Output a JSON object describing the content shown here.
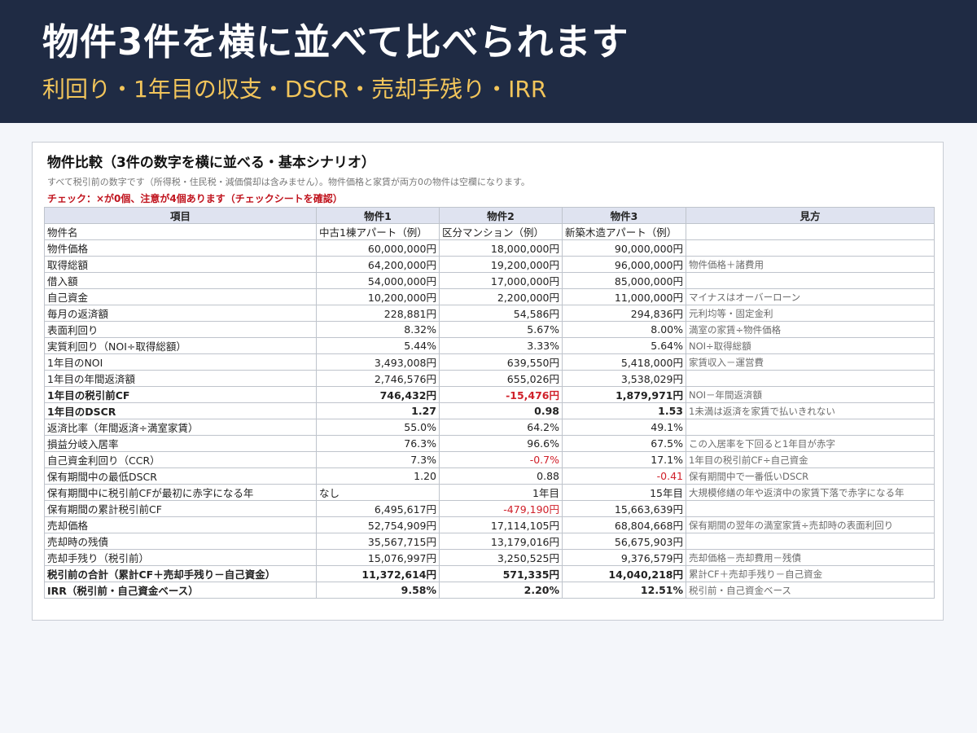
{
  "header": {
    "title": "物件3件を横に並べて比べられます",
    "subtitle": "利回り・1年目の収支・DSCR・売却手残り・IRR"
  },
  "panel": {
    "title": "物件比較（3件の数字を横に並べる・基本シナリオ）",
    "note": "すべて税引前の数字です（所得税・住民税・減価償却は含みません）。物件価格と家賃が両方0の物件は空欄になります。",
    "check": "チェック：×が0個、注意が4個あります（チェックシートを確認）"
  },
  "table": {
    "headers": [
      "項目",
      "物件1",
      "物件2",
      "物件3",
      "見方"
    ],
    "rows": [
      {
        "label": "物件名",
        "values": [
          "中古1棟アパート（例）",
          "区分マンション（例）",
          "新築木造アパート（例）"
        ],
        "note": "",
        "align": "left"
      },
      {
        "label": "物件価格",
        "values": [
          "60,000,000円",
          "18,000,000円",
          "90,000,000円"
        ],
        "note": ""
      },
      {
        "label": "取得総額",
        "values": [
          "64,200,000円",
          "19,200,000円",
          "96,000,000円"
        ],
        "note": "物件価格＋諸費用"
      },
      {
        "label": "借入額",
        "values": [
          "54,000,000円",
          "17,000,000円",
          "85,000,000円"
        ],
        "note": ""
      },
      {
        "label": "自己資金",
        "values": [
          "10,200,000円",
          "2,200,000円",
          "11,000,000円"
        ],
        "note": "マイナスはオーバーローン"
      },
      {
        "label": "毎月の返済額",
        "values": [
          "228,881円",
          "54,586円",
          "294,836円"
        ],
        "note": "元利均等・固定金利"
      },
      {
        "label": "表面利回り",
        "values": [
          "8.32%",
          "5.67%",
          "8.00%"
        ],
        "note": "満室の家賃÷物件価格"
      },
      {
        "label": "実質利回り（NOI÷取得総額）",
        "values": [
          "5.44%",
          "3.33%",
          "5.64%"
        ],
        "note": "NOI÷取得総額"
      },
      {
        "label": "1年目のNOI",
        "values": [
          "3,493,008円",
          "639,550円",
          "5,418,000円"
        ],
        "note": "家賃収入－運営費"
      },
      {
        "label": "1年目の年間返済額",
        "values": [
          "2,746,576円",
          "655,026円",
          "3,538,029円"
        ],
        "note": ""
      },
      {
        "label": "1年目の税引前CF",
        "values": [
          "746,432円",
          "-15,476円",
          "1,879,971円"
        ],
        "note": "NOI－年間返済額",
        "bold": true,
        "neg": [
          false,
          true,
          false
        ]
      },
      {
        "label": "1年目のDSCR",
        "values": [
          "1.27",
          "0.98",
          "1.53"
        ],
        "note": "1未満は返済を家賃で払いきれない",
        "bold": true
      },
      {
        "label": "返済比率（年間返済÷満室家賃）",
        "values": [
          "55.0%",
          "64.2%",
          "49.1%"
        ],
        "note": ""
      },
      {
        "label": "損益分岐入居率",
        "values": [
          "76.3%",
          "96.6%",
          "67.5%"
        ],
        "note": "この入居率を下回ると1年目が赤字"
      },
      {
        "label": "自己資金利回り（CCR）",
        "values": [
          "7.3%",
          "-0.7%",
          "17.1%"
        ],
        "note": "1年目の税引前CF÷自己資金",
        "neg": [
          false,
          true,
          false
        ]
      },
      {
        "label": "保有期間中の最低DSCR",
        "values": [
          "1.20",
          "0.88",
          "-0.41"
        ],
        "note": "保有期間中で一番低いDSCR",
        "neg": [
          false,
          false,
          true
        ]
      },
      {
        "label": "保有期間中に税引前CFが最初に赤字になる年",
        "values": [
          "なし",
          "1年目",
          "15年目"
        ],
        "note": "大規模修繕の年や返済中の家賃下落で赤字になる年",
        "alignFirst": "left"
      },
      {
        "label": "保有期間の累計税引前CF",
        "values": [
          "6,495,617円",
          "-479,190円",
          "15,663,639円"
        ],
        "note": "",
        "neg": [
          false,
          true,
          false
        ]
      },
      {
        "label": "売却価格",
        "values": [
          "52,754,909円",
          "17,114,105円",
          "68,804,668円"
        ],
        "note": "保有期間の翌年の満室家賃÷売却時の表面利回り"
      },
      {
        "label": "売却時の残債",
        "values": [
          "35,567,715円",
          "13,179,016円",
          "56,675,903円"
        ],
        "note": ""
      },
      {
        "label": "売却手残り（税引前）",
        "values": [
          "15,076,997円",
          "3,250,525円",
          "9,376,579円"
        ],
        "note": "売却価格－売却費用－残債"
      },
      {
        "label": "税引前の合計（累計CF＋売却手残り－自己資金）",
        "values": [
          "11,372,614円",
          "571,335円",
          "14,040,218円"
        ],
        "note": "累計CF＋売却手残り－自己資金",
        "bold": true
      },
      {
        "label": "IRR（税引前・自己資金ベース）",
        "values": [
          "9.58%",
          "2.20%",
          "12.51%"
        ],
        "note": "税引前・自己資金ベース",
        "bold": true
      }
    ]
  }
}
